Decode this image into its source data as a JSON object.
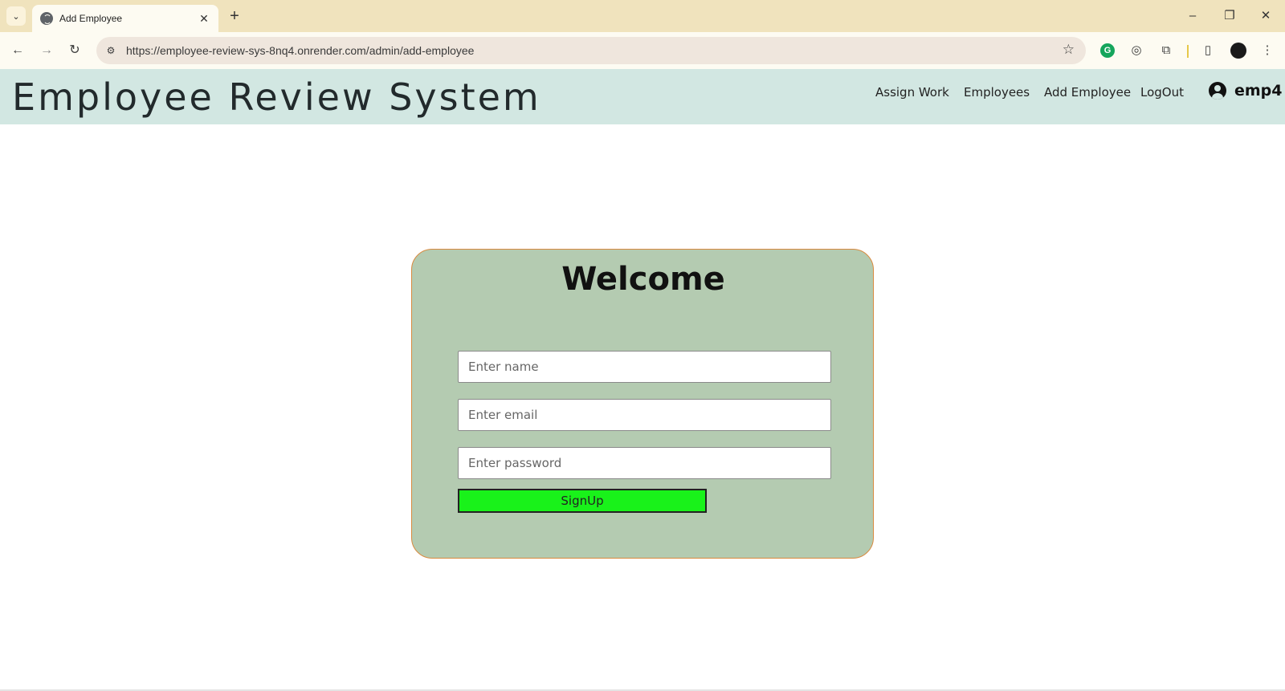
{
  "browser": {
    "tab_title": "Add Employee",
    "url": "https://employee-review-sys-8nq4.onrender.com/admin/add-employee"
  },
  "header": {
    "brand": "Employee Review System",
    "nav": [
      "Assign Work",
      "Employees",
      "Add Employee",
      "LogOut"
    ],
    "user": "emp4"
  },
  "form": {
    "title": "Welcome",
    "name_placeholder": "Enter name",
    "email_placeholder": "Enter email",
    "password_placeholder": "Enter password",
    "submit_label": "SignUp"
  },
  "colors": {
    "header_bg": "#d2e7e2",
    "card_bg": "#b4cbb1",
    "card_border": "#d98a3f",
    "button_bg": "#19f21a"
  }
}
